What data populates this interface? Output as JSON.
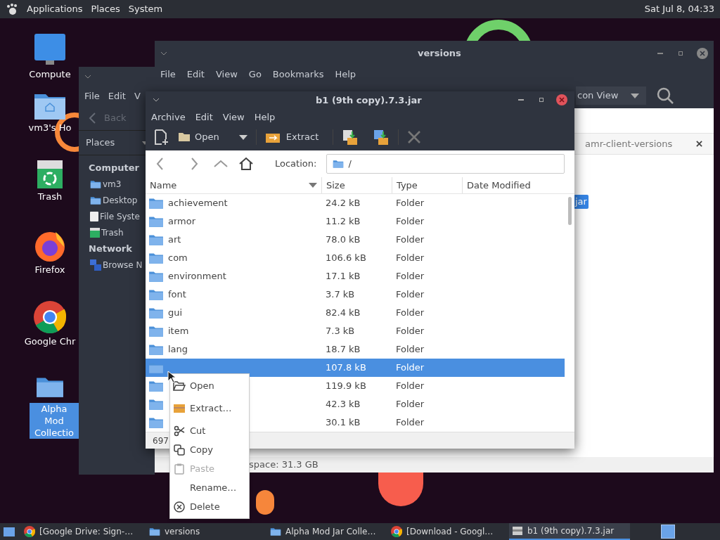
{
  "top_panel": {
    "menus": [
      "Applications",
      "Places",
      "System"
    ],
    "clock": "Sat Jul 8, 04:33"
  },
  "desktop_icons": [
    {
      "kind": "computer",
      "label": "Compute",
      "selected": false
    },
    {
      "kind": "home",
      "label": "vm3's Ho",
      "selected": false
    },
    {
      "kind": "trash",
      "label": "Trash",
      "selected": false
    },
    {
      "kind": "firefox",
      "label": "Firefox",
      "selected": false
    },
    {
      "kind": "chrome",
      "label": "Google Chr",
      "selected": false
    },
    {
      "kind": "folder",
      "label": "Alpha Mod Collectio",
      "selected": true
    }
  ],
  "back_window": {
    "menus": [
      "File",
      "Edit",
      "V"
    ],
    "back": "Back",
    "places": "Places",
    "sidebar": [
      {
        "kind": "heading",
        "label": "Computer"
      },
      {
        "kind": "home",
        "label": "vm3"
      },
      {
        "kind": "desktop",
        "label": "Desktop"
      },
      {
        "kind": "drive",
        "label": "File Syste"
      },
      {
        "kind": "trash",
        "label": "Trash"
      },
      {
        "kind": "heading",
        "label": "Network"
      },
      {
        "kind": "network",
        "label": "Browse N"
      }
    ]
  },
  "versions_window": {
    "title": "versions",
    "menus": [
      "File",
      "Edit",
      "View",
      "Go",
      "Bookmarks",
      "Help"
    ],
    "view_mode": "con View",
    "tab": "amr-client-versions",
    "selected_item": "jar",
    "status": "space: 31.3 GB"
  },
  "archive_window": {
    "title": "b1 (9th copy).7.3.jar",
    "menus": [
      "Archive",
      "Edit",
      "View",
      "Help"
    ],
    "toolbar": {
      "open": "Open",
      "extract": "Extract"
    },
    "location_label": "Location:",
    "location": "/",
    "columns": [
      "Name",
      "Size",
      "Type",
      "Date Modified"
    ],
    "rows": [
      {
        "name": "achievement",
        "size": "24.2 kB",
        "type": "Folder",
        "selected": false
      },
      {
        "name": "armor",
        "size": "11.2 kB",
        "type": "Folder",
        "selected": false
      },
      {
        "name": "art",
        "size": "78.0 kB",
        "type": "Folder",
        "selected": false
      },
      {
        "name": "com",
        "size": "106.6 kB",
        "type": "Folder",
        "selected": false
      },
      {
        "name": "environment",
        "size": "17.1 kB",
        "type": "Folder",
        "selected": false
      },
      {
        "name": "font",
        "size": "3.7 kB",
        "type": "Folder",
        "selected": false
      },
      {
        "name": "gui",
        "size": "82.4 kB",
        "type": "Folder",
        "selected": false
      },
      {
        "name": "item",
        "size": "7.3 kB",
        "type": "Folder",
        "selected": false
      },
      {
        "name": "lang",
        "size": "18.7 kB",
        "type": "Folder",
        "selected": false
      },
      {
        "size": "107.8 kB",
        "type": "Folder",
        "selected": true
      },
      {
        "size": "119.9 kB",
        "type": "Folder",
        "selected": false
      },
      {
        "size": "42.3 kB",
        "type": "Folder",
        "selected": false
      },
      {
        "size": "30.1 kB",
        "type": "Folder",
        "selected": false
      }
    ],
    "status": "697"
  },
  "context_menu": [
    {
      "kind": "open",
      "label": "Open",
      "disabled": false
    },
    {
      "kind": "separator"
    },
    {
      "kind": "extract",
      "label": "Extract…",
      "disabled": false
    },
    {
      "kind": "separator"
    },
    {
      "kind": "cut",
      "label": "Cut",
      "disabled": false
    },
    {
      "kind": "copy",
      "label": "Copy",
      "disabled": false
    },
    {
      "kind": "paste",
      "label": "Paste",
      "disabled": true
    },
    {
      "kind": "rename",
      "label": "Rename…",
      "disabled": false
    },
    {
      "kind": "delete",
      "label": "Delete",
      "disabled": false
    }
  ],
  "taskbar": [
    {
      "kind": "chrome",
      "label": "[Google Drive: Sign-…",
      "selected": false
    },
    {
      "kind": "folder",
      "label": "versions",
      "selected": false
    },
    {
      "kind": "folder",
      "label": "Alpha Mod Jar Colle…",
      "selected": false
    },
    {
      "kind": "chrome",
      "label": "[Download - Googl…",
      "selected": false
    },
    {
      "kind": "archive",
      "label": "b1 (9th copy).7.3.jar",
      "selected": true
    }
  ]
}
